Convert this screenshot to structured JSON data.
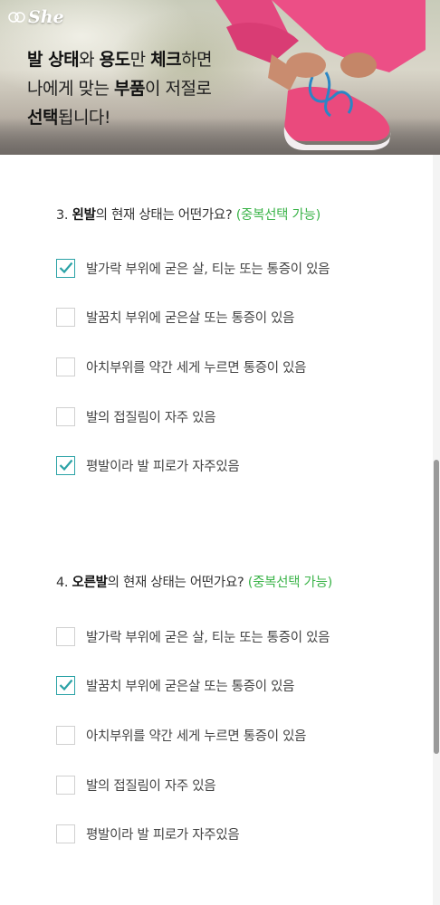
{
  "brand": {
    "logo_text": "She"
  },
  "hero": {
    "line1": {
      "b1": "발 상태",
      "t1": "와 ",
      "b2": "용도",
      "t2": "만 ",
      "b3": "체크",
      "t3": "하면"
    },
    "line2": {
      "t1": "나에게 맞는 ",
      "b1": "부품",
      "t2": "이 저절로"
    },
    "line3": {
      "b1": "선택",
      "t1": "됩니다!"
    }
  },
  "questions": [
    {
      "prefix": "3. ",
      "foot": "왼발",
      "text": "의 현재 상태는 어떤가요? ",
      "hint": "(중복선택 가능)",
      "options": [
        {
          "label": "발가락 부위에 굳은 살, 티눈 또는 통증이 있음",
          "checked": true
        },
        {
          "label": "발꿈치 부위에 굳은살 또는 통증이 있음",
          "checked": false
        },
        {
          "label": "아치부위를 약간 세게 누르면 통증이 있음",
          "checked": false
        },
        {
          "label": "발의 접질림이 자주 있음",
          "checked": false
        },
        {
          "label": "평발이라 발 피로가 자주있음",
          "checked": true
        }
      ]
    },
    {
      "prefix": "4. ",
      "foot": "오른발",
      "text": "의 현재 상태는 어떤가요? ",
      "hint": "(중복선택 가능)",
      "options": [
        {
          "label": "발가락 부위에 굳은 살, 티눈 또는 통증이 있음",
          "checked": false
        },
        {
          "label": "발꿈치 부위에 굳은살 또는 통증이 있음",
          "checked": true
        },
        {
          "label": "아치부위를 약간 세게 누르면 통증이 있음",
          "checked": false
        },
        {
          "label": "발의 접질림이 자주 있음",
          "checked": false
        },
        {
          "label": "평발이라 발 피로가 자주있음",
          "checked": false
        }
      ]
    }
  ],
  "colors": {
    "accent_teal": "#2aa2a6",
    "hint_green": "#3cb44a",
    "text_dark": "#333333",
    "shoe_pink": "#e8457c",
    "lace_blue": "#2b86c5"
  }
}
